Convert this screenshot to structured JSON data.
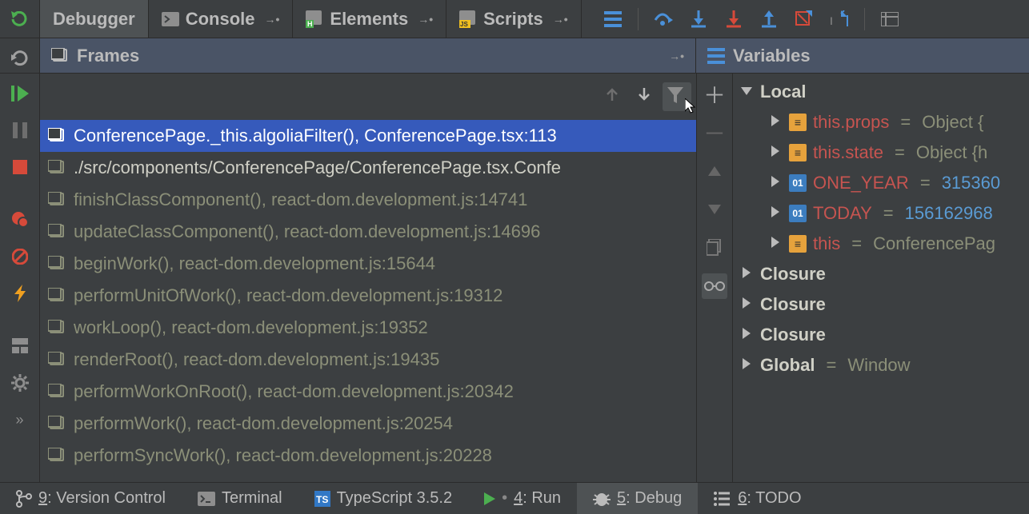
{
  "tabs": [
    {
      "label": "Debugger",
      "icon": null,
      "active": true,
      "pin": false
    },
    {
      "label": "Console",
      "icon": "console-icon",
      "active": false,
      "pin": true
    },
    {
      "label": "Elements",
      "icon": "elements-icon",
      "active": false,
      "pin": true
    },
    {
      "label": "Scripts",
      "icon": "scripts-icon",
      "active": false,
      "pin": true
    }
  ],
  "panels": {
    "frames": "Frames",
    "variables": "Variables"
  },
  "frames": [
    {
      "text": "ConferencePage._this.algoliaFilter(), ConferencePage.tsx:113",
      "selected": true,
      "style": "selected"
    },
    {
      "text": "./src/components/ConferencePage/ConferencePage.tsx.Confe",
      "selected": false,
      "style": "bright"
    },
    {
      "text": "finishClassComponent(), react-dom.development.js:14741",
      "selected": false,
      "style": "dim"
    },
    {
      "text": "updateClassComponent(), react-dom.development.js:14696",
      "selected": false,
      "style": "dim"
    },
    {
      "text": "beginWork(), react-dom.development.js:15644",
      "selected": false,
      "style": "dim"
    },
    {
      "text": "performUnitOfWork(), react-dom.development.js:19312",
      "selected": false,
      "style": "dim"
    },
    {
      "text": "workLoop(), react-dom.development.js:19352",
      "selected": false,
      "style": "dim"
    },
    {
      "text": "renderRoot(), react-dom.development.js:19435",
      "selected": false,
      "style": "dim"
    },
    {
      "text": "performWorkOnRoot(), react-dom.development.js:20342",
      "selected": false,
      "style": "dim"
    },
    {
      "text": "performWork(), react-dom.development.js:20254",
      "selected": false,
      "style": "dim"
    },
    {
      "text": "performSyncWork(), react-dom.development.js:20228",
      "selected": false,
      "style": "dim"
    }
  ],
  "variables": {
    "local_label": "Local",
    "locals": [
      {
        "kind": "obj",
        "name": "this.props",
        "eq": "=",
        "val": "Object {"
      },
      {
        "kind": "obj",
        "name": "this.state",
        "eq": "=",
        "val": "Object {h"
      },
      {
        "kind": "num",
        "name": "ONE_YEAR",
        "eq": "=",
        "val": "315360"
      },
      {
        "kind": "num",
        "name": "TODAY",
        "eq": "=",
        "val": "156162968"
      },
      {
        "kind": "obj",
        "name": "this",
        "eq": "=",
        "val": "ConferencePag"
      }
    ],
    "scopes": [
      {
        "name": "Closure",
        "val": ""
      },
      {
        "name": "Closure",
        "val": ""
      },
      {
        "name": "Closure",
        "val": ""
      },
      {
        "name": "Global",
        "val": "Window"
      }
    ]
  },
  "status_bar": {
    "vcs_key": "9",
    "vcs_label": ": Version Control",
    "terminal": "Terminal",
    "ts": "TypeScript 3.5.2",
    "run_key": "4",
    "run_label": ": Run",
    "debug_key": "5",
    "debug_label": ": Debug",
    "todo_key": "6",
    "todo_label": ": TODO"
  }
}
